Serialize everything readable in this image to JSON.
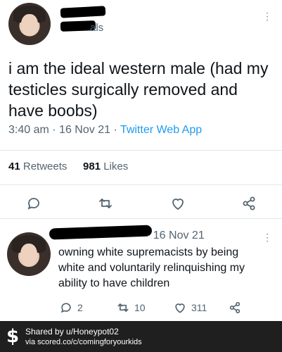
{
  "main_tweet": {
    "handle_fragment": "als",
    "text": "i am the ideal western male (had my testicles surgically removed and have boobs)",
    "time": "3:40 am",
    "date": "16 Nov 21",
    "source": "Twitter Web App",
    "retweets_count": "41",
    "retweets_label": "Retweets",
    "likes_count": "981",
    "likes_label": "Likes"
  },
  "reply_tweet": {
    "date": "· 16 Nov 21",
    "text": "owning white supremacists by being white and voluntarily relinquishing my ability to have children",
    "reply_count": "2",
    "retweet_count": "10",
    "like_count": "311"
  },
  "footer": {
    "shared_by": "Shared by u/Honeypot02",
    "via": "via scored.co/c/comingforyourkids"
  },
  "colors": {
    "link": "#1d9bf0",
    "icon": "#536471",
    "footer_bg": "#1f1f1f"
  }
}
